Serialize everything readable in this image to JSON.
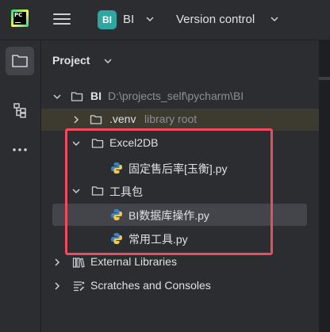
{
  "app": {
    "logo_text": "PC",
    "project_badge": "BI",
    "project_name": "BI",
    "vcs_label": "Version control"
  },
  "sidebar": {
    "items": [
      {
        "icon": "folder-icon",
        "active": true
      },
      {
        "icon": "structure-icon",
        "active": false
      },
      {
        "icon": "more-icon",
        "active": false
      }
    ]
  },
  "project_panel": {
    "title": "Project",
    "tree": [
      {
        "label": "BI",
        "hint": "D:\\projects_self\\pycharm\\BI",
        "type": "folder",
        "expanded": true
      },
      {
        "label": ".venv",
        "hint": "library root",
        "type": "folder",
        "expanded": false
      },
      {
        "label": "Excel2DB",
        "type": "folder",
        "expanded": true
      },
      {
        "label": "固定售后率[玉衡].py",
        "type": "python"
      },
      {
        "label": "工具包",
        "type": "folder",
        "expanded": true
      },
      {
        "label": "BI数据库操作.py",
        "type": "python",
        "selected": true
      },
      {
        "label": "常用工具.py",
        "type": "python"
      },
      {
        "label": "External Libraries",
        "type": "library",
        "expanded": false
      },
      {
        "label": "Scratches and Consoles",
        "type": "scratches",
        "expanded": false
      }
    ]
  },
  "colors": {
    "background": "#2b2d30",
    "selection": "#43454a",
    "highlight_box": "#ef4a5e",
    "badge": "#2ea6a1"
  }
}
